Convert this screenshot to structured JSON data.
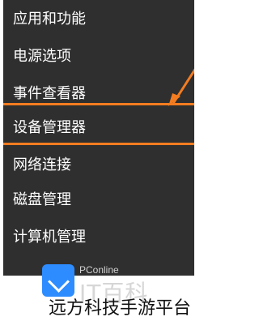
{
  "menu": {
    "items": [
      {
        "label": "应用和功能"
      },
      {
        "label": "电源选项"
      },
      {
        "label": "事件查看器"
      },
      {
        "label": "设备管理器"
      },
      {
        "label": "网络连接"
      },
      {
        "label": "磁盘管理"
      },
      {
        "label": "计算机管理"
      }
    ],
    "highlighted_item": "设备管理器"
  },
  "colors": {
    "menu_background": "#2f2f2f",
    "highlight": "#f47c20",
    "logo_blue": "#2d8cff"
  },
  "logo": {
    "small": "PConline",
    "big": "IT百科"
  },
  "watermark": "远方科技手游平台"
}
